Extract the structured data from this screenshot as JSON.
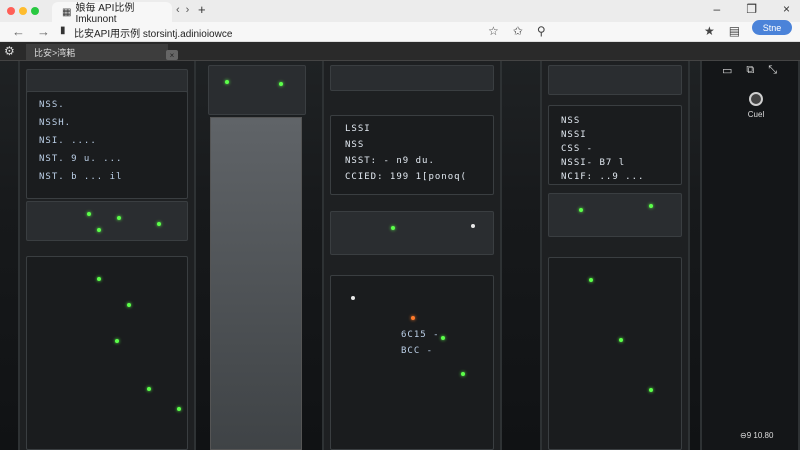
{
  "browser": {
    "tab_title": "娘毎 API比例 Imkunont",
    "tab_icon": "grid-icon",
    "new_tab_icon": "plus-icon",
    "window_controls": [
      "–",
      "❐",
      "×"
    ]
  },
  "toolbar": {
    "url_text": "比安API用示例 storsintj.adinioiowce",
    "sign_label": "Stne"
  },
  "subtab": {
    "label": "比安>湾耜",
    "close_glyph": "×"
  },
  "viewer": {
    "camera_label": "Cuel",
    "corner_text": "⊖9 10.80",
    "rack_text": {
      "left": [
        "NSS.",
        "NSSH.",
        "NSI. ....",
        "NST. 9 u. ...",
        "NST. b ... il"
      ],
      "middle": [
        "LSSI",
        "NSS",
        "NSST: - n9 du.",
        "CCIED: 199 1[ponoq(",
        "",
        "",
        "",
        "",
        "6C15 -",
        "BCC -"
      ],
      "right": [
        "NSS",
        "NSSI",
        "CSS -",
        "NSSI- B7 l",
        "NC1F: ..9 ..."
      ]
    }
  },
  "colors": {
    "accent_blue": "#4b83d9",
    "led_green": "#5cff4a",
    "led_orange": "#ff7a2a"
  }
}
